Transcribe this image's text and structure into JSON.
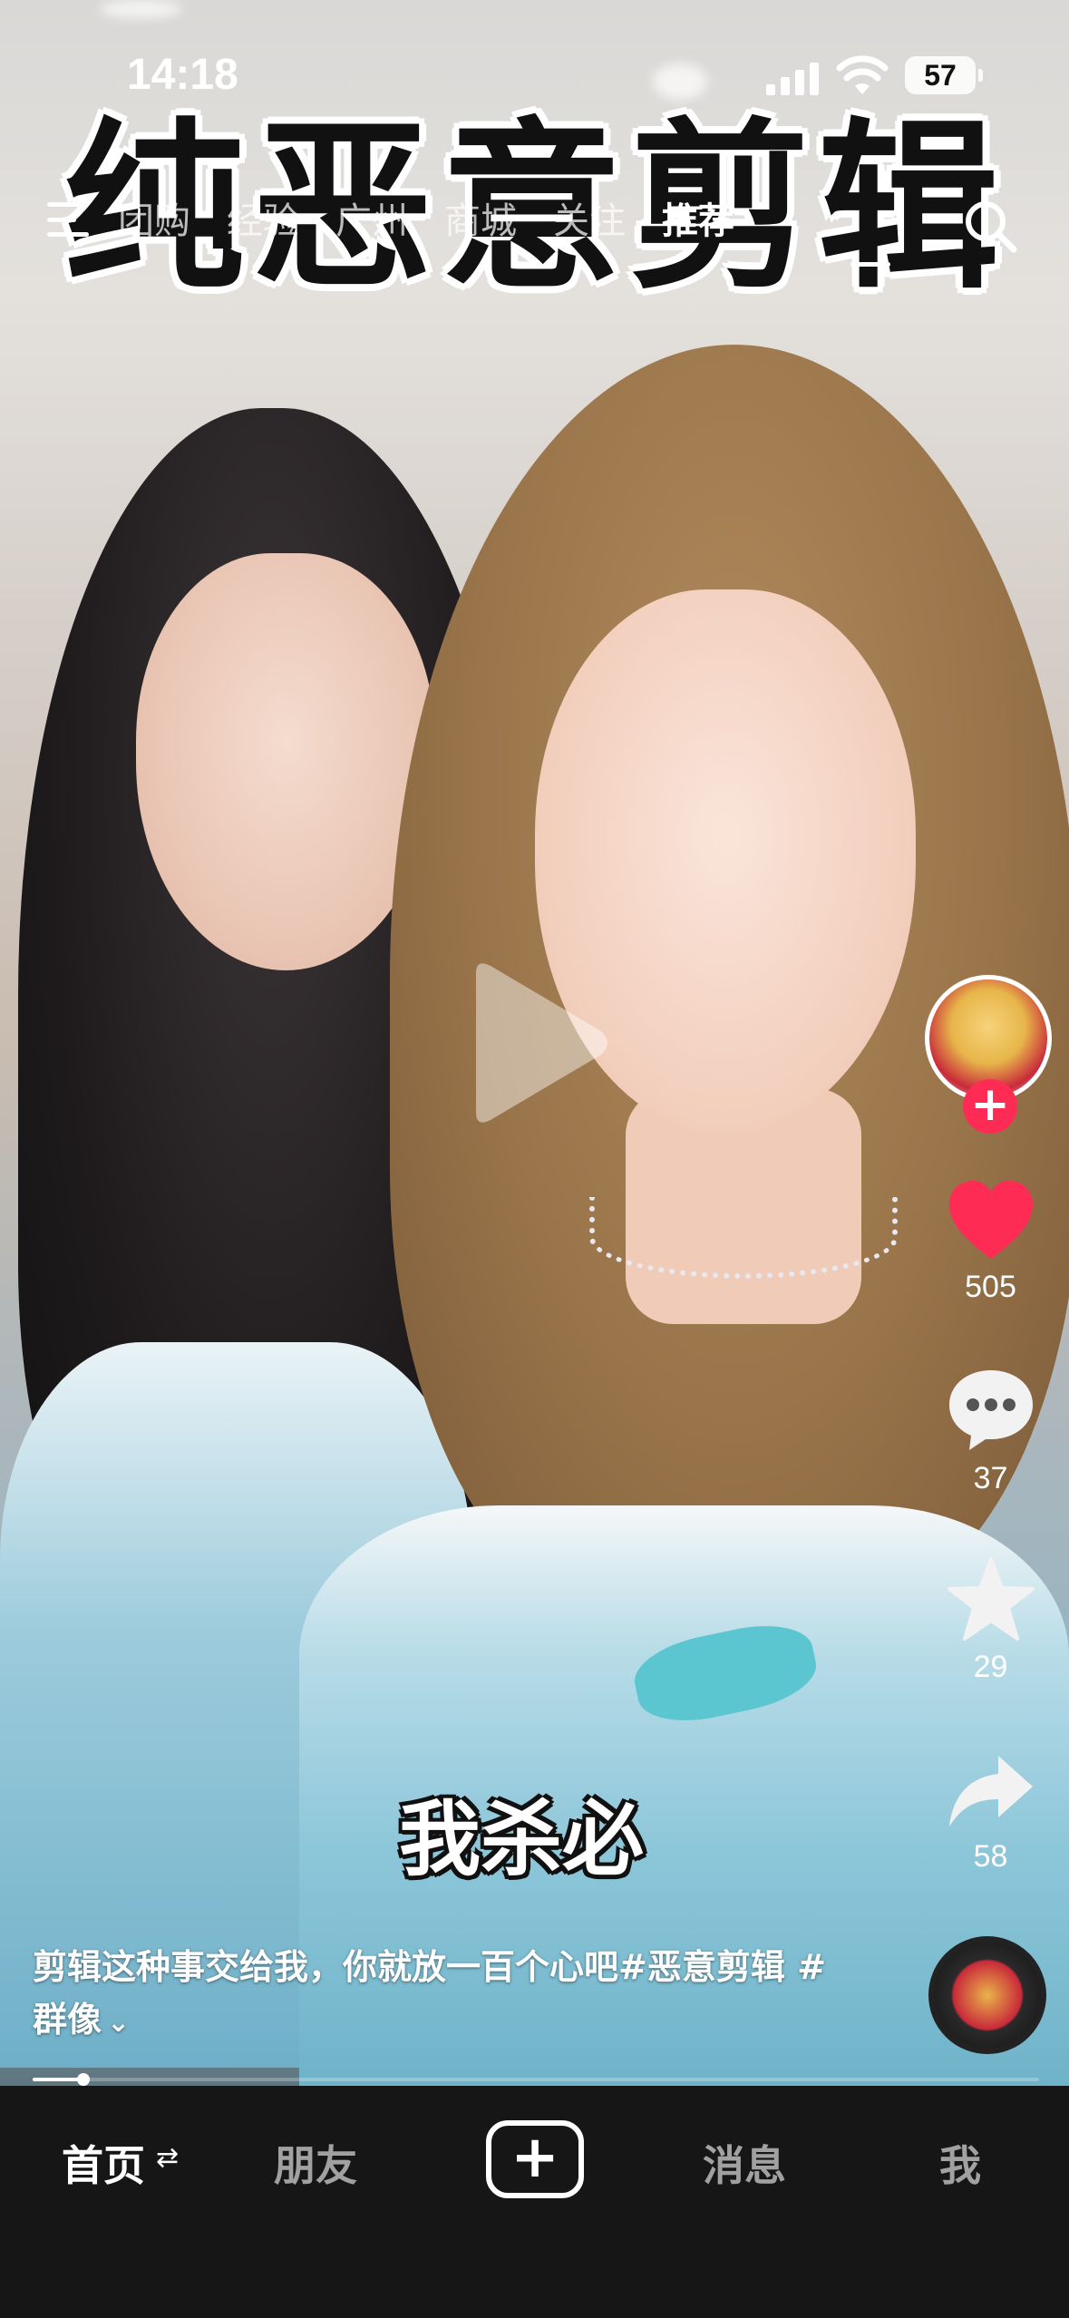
{
  "status_bar": {
    "time": "14:18",
    "battery": "57"
  },
  "overlay_title": "纯恶意剪辑",
  "top_nav": {
    "tabs": [
      "团购",
      "经验",
      "广州",
      "商城",
      "关注",
      "推荐"
    ],
    "active_tab": "推荐"
  },
  "subtitle": "我杀必",
  "actions": {
    "like_count": "505",
    "comment_count": "37",
    "favorite_count": "29",
    "share_count": "58"
  },
  "caption": {
    "text": "剪辑这种事交给我，你就放一百个心吧#恶意剪辑 #群像",
    "more_icon": "chevron-down-icon"
  },
  "progress": {
    "played_fraction": 0.05
  },
  "bottom_tabs": {
    "home": "首页",
    "friends": "朋友",
    "messages": "消息",
    "me": "我"
  },
  "colors": {
    "accent": "#fe2c55",
    "like": "#fe2c55",
    "tab_bar": "#161616"
  }
}
